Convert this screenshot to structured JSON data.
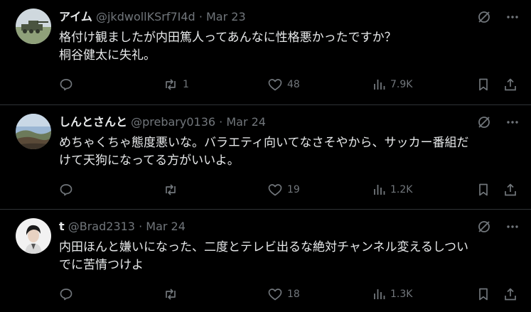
{
  "tweets": [
    {
      "name": "アイム",
      "handle": "@jkdwollKSrf7I4d",
      "sep": "·",
      "date": "Mar 23",
      "lines": [
        "格付け観ましたが内田篤人ってあんなに性格悪かったですか？",
        "桐谷健太に失礼。"
      ],
      "replies": "",
      "retweets": "1",
      "likes": "48",
      "views": "7.9K"
    },
    {
      "name": "しんとさんと",
      "handle": "@prebary0136",
      "sep": "·",
      "date": "Mar 24",
      "lines": [
        "めちゃくちゃ態度悪いな。バラエティ向いてなさそやから、サッカー番組だ",
        "けて天狗になってる方がいいよ。"
      ],
      "replies": "",
      "retweets": "",
      "likes": "19",
      "views": "1.2K"
    },
    {
      "name": "t",
      "handle": "@Brad2313",
      "sep": "·",
      "date": "Mar 24",
      "lines": [
        "内田ほんと嫌いになった、二度とテレビ出るな絶対チャンネル変えるしつい",
        "でに苦情つけよ"
      ],
      "replies": "",
      "retweets": "",
      "likes": "18",
      "views": "1.3K"
    }
  ],
  "icons": {
    "top": [
      "grok-icon",
      "more-icon"
    ],
    "actions": [
      "reply-icon",
      "retweet-icon",
      "like-icon",
      "views-icon",
      "bookmark-icon",
      "share-icon"
    ]
  },
  "colors": {
    "background": "#000000",
    "text": "#e7e9ea",
    "secondary": "#71767b",
    "divider": "#2f3336"
  }
}
